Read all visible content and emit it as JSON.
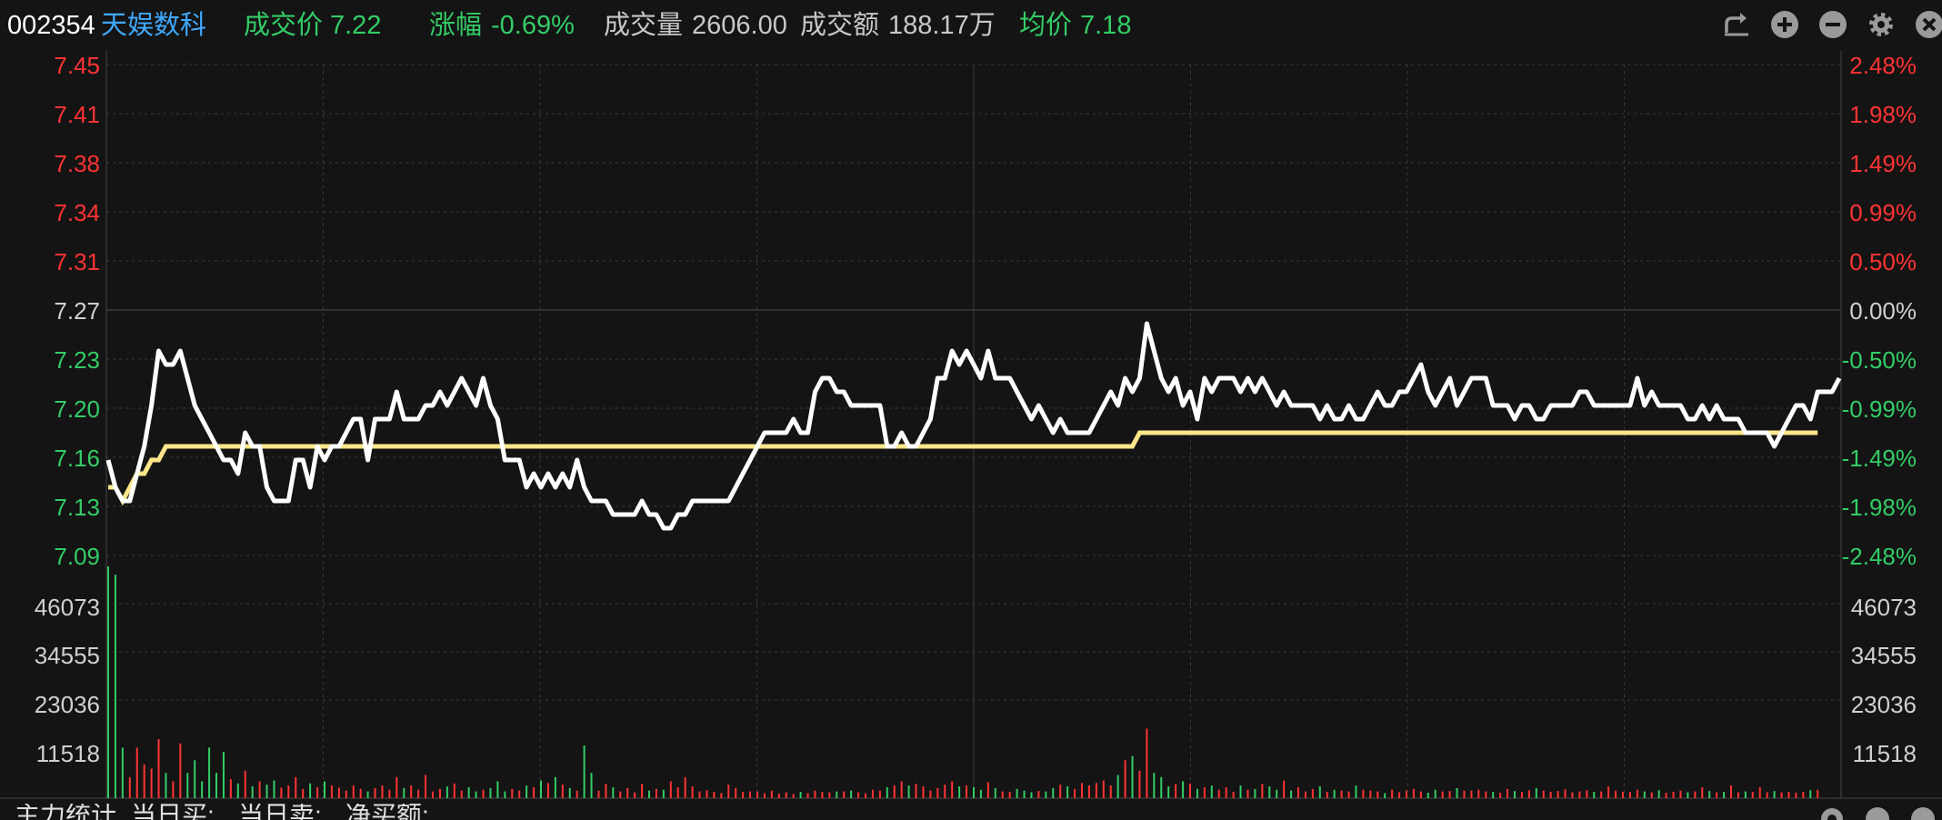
{
  "header": {
    "code": "002354",
    "name": "天娱数科",
    "price_label": "成交价",
    "price": "7.22",
    "change_label": "涨幅",
    "change": "-0.69%",
    "volume_label": "成交量",
    "volume": "2606.00",
    "amount_label": "成交额",
    "amount": "188.17万",
    "avg_label": "均价",
    "avg": "7.18",
    "icons": [
      "refresh-icon",
      "zoom-in-icon",
      "zoom-out-icon",
      "gear-icon",
      "close-icon"
    ]
  },
  "footer": {
    "l1": "主力统计",
    "l2": "当日买:",
    "l3": "当日卖:",
    "l4": "净买额:",
    "icons": [
      "gear-icon",
      "help-icon",
      "close-icon"
    ]
  },
  "colors": {
    "up": "#ff3333",
    "down": "#33cc66",
    "price_line": "#ffffff",
    "avg_line": "#ffe68a",
    "grid": "#3a3a3a",
    "accent": "#3fa9ff"
  },
  "chart_data": {
    "type": "line",
    "price_ylim": [
      7.09,
      7.45
    ],
    "left_ticks": [
      "7.45",
      "7.41",
      "7.38",
      "7.34",
      "7.31",
      "7.27",
      "7.23",
      "7.20",
      "7.16",
      "7.13",
      "7.09"
    ],
    "right_ticks": [
      "2.48%",
      "1.98%",
      "1.49%",
      "0.99%",
      "0.50%",
      "0.00%",
      "-0.50%",
      "-0.99%",
      "-1.49%",
      "-1.98%",
      "-2.48%"
    ],
    "prev_close": 7.27,
    "volume_ylim": [
      0,
      57591
    ],
    "volume_ticks": [
      "46073",
      "34555",
      "23036",
      "11518"
    ],
    "total_points": 241,
    "price": [
      7.16,
      7.14,
      7.13,
      7.13,
      7.15,
      7.17,
      7.2,
      7.24,
      7.23,
      7.23,
      7.24,
      7.22,
      7.2,
      7.19,
      7.18,
      7.17,
      7.16,
      7.16,
      7.15,
      7.18,
      7.17,
      7.17,
      7.14,
      7.13,
      7.13,
      7.13,
      7.16,
      7.16,
      7.14,
      7.17,
      7.16,
      7.17,
      7.17,
      7.18,
      7.19,
      7.19,
      7.16,
      7.19,
      7.19,
      7.19,
      7.21,
      7.19,
      7.19,
      7.19,
      7.2,
      7.2,
      7.21,
      7.2,
      7.21,
      7.22,
      7.21,
      7.2,
      7.22,
      7.2,
      7.19,
      7.16,
      7.16,
      7.16,
      7.14,
      7.15,
      7.14,
      7.15,
      7.14,
      7.15,
      7.14,
      7.16,
      7.14,
      7.13,
      7.13,
      7.13,
      7.12,
      7.12,
      7.12,
      7.12,
      7.13,
      7.12,
      7.12,
      7.11,
      7.11,
      7.12,
      7.12,
      7.13,
      7.13,
      7.13,
      7.13,
      7.13,
      7.13,
      7.14,
      7.15,
      7.16,
      7.17,
      7.18,
      7.18,
      7.18,
      7.18,
      7.19,
      7.18,
      7.18,
      7.21,
      7.22,
      7.22,
      7.21,
      7.21,
      7.2,
      7.2,
      7.2,
      7.2,
      7.2,
      7.17,
      7.17,
      7.18,
      7.17,
      7.17,
      7.18,
      7.19,
      7.22,
      7.22,
      7.24,
      7.23,
      7.24,
      7.23,
      7.22,
      7.24,
      7.22,
      7.22,
      7.22,
      7.21,
      7.2,
      7.19,
      7.2,
      7.19,
      7.18,
      7.19,
      7.18,
      7.18,
      7.18,
      7.18,
      7.19,
      7.2,
      7.21,
      7.2,
      7.22,
      7.21,
      7.22,
      7.26,
      7.24,
      7.22,
      7.21,
      7.22,
      7.2,
      7.21,
      7.19,
      7.22,
      7.21,
      7.22,
      7.22,
      7.22,
      7.21,
      7.22,
      7.21,
      7.22,
      7.21,
      7.2,
      7.21,
      7.2,
      7.2,
      7.2,
      7.2,
      7.19,
      7.2,
      7.19,
      7.19,
      7.2,
      7.19,
      7.19,
      7.2,
      7.21,
      7.2,
      7.2,
      7.21,
      7.21,
      7.22,
      7.23,
      7.21,
      7.2,
      7.21,
      7.22,
      7.2,
      7.21,
      7.22,
      7.22,
      7.22,
      7.2,
      7.2,
      7.2,
      7.19,
      7.2,
      7.2,
      7.19,
      7.19,
      7.2,
      7.2,
      7.2,
      7.2,
      7.21,
      7.21,
      7.2,
      7.2,
      7.2,
      7.2,
      7.2,
      7.2,
      7.22,
      7.2,
      7.21,
      7.2,
      7.2,
      7.2,
      7.2,
      7.19,
      7.19,
      7.2,
      7.19,
      7.2,
      7.19,
      7.19,
      7.19,
      7.18,
      7.18,
      7.18,
      7.18,
      7.17,
      7.18,
      7.19,
      7.2,
      7.2,
      7.19,
      7.21,
      7.21,
      7.21,
      7.22
    ],
    "avg_price": [
      7.14,
      7.14,
      7.13,
      7.14,
      7.15,
      7.15,
      7.16,
      7.16,
      7.17,
      7.17,
      7.17,
      7.17,
      7.17,
      7.17,
      7.17,
      7.17,
      7.17,
      7.17,
      7.17,
      7.17,
      7.17,
      7.17,
      7.17,
      7.17,
      7.17,
      7.17,
      7.17,
      7.17,
      7.17,
      7.17,
      7.17,
      7.17,
      7.17,
      7.17,
      7.17,
      7.17,
      7.17,
      7.17,
      7.17,
      7.17,
      7.17,
      7.17,
      7.17,
      7.17,
      7.17,
      7.17,
      7.17,
      7.17,
      7.17,
      7.17,
      7.17,
      7.17,
      7.17,
      7.17,
      7.17,
      7.17,
      7.17,
      7.17,
      7.17,
      7.17,
      7.17,
      7.17,
      7.17,
      7.17,
      7.17,
      7.17,
      7.17,
      7.17,
      7.17,
      7.17,
      7.17,
      7.17,
      7.17,
      7.17,
      7.17,
      7.17,
      7.17,
      7.17,
      7.17,
      7.17,
      7.17,
      7.17,
      7.17,
      7.17,
      7.17,
      7.17,
      7.17,
      7.17,
      7.17,
      7.17,
      7.17,
      7.17,
      7.17,
      7.17,
      7.17,
      7.17,
      7.17,
      7.17,
      7.17,
      7.17,
      7.17,
      7.17,
      7.17,
      7.17,
      7.17,
      7.17,
      7.17,
      7.17,
      7.17,
      7.17,
      7.17,
      7.17,
      7.17,
      7.17,
      7.17,
      7.17,
      7.17,
      7.17,
      7.17,
      7.17,
      7.17,
      7.17,
      7.17,
      7.17,
      7.17,
      7.17,
      7.17,
      7.17,
      7.17,
      7.17,
      7.17,
      7.17,
      7.17,
      7.17,
      7.17,
      7.17,
      7.17,
      7.17,
      7.17,
      7.17,
      7.17,
      7.17,
      7.17,
      7.18,
      7.18,
      7.18,
      7.18,
      7.18,
      7.18,
      7.18,
      7.18,
      7.18,
      7.18,
      7.18,
      7.18,
      7.18,
      7.18,
      7.18,
      7.18,
      7.18,
      7.18,
      7.18,
      7.18,
      7.18,
      7.18,
      7.18,
      7.18,
      7.18,
      7.18,
      7.18,
      7.18,
      7.18,
      7.18,
      7.18,
      7.18,
      7.18,
      7.18,
      7.18,
      7.18,
      7.18,
      7.18,
      7.18,
      7.18,
      7.18,
      7.18,
      7.18,
      7.18,
      7.18,
      7.18,
      7.18,
      7.18,
      7.18,
      7.18,
      7.18,
      7.18,
      7.18,
      7.18,
      7.18,
      7.18,
      7.18,
      7.18,
      7.18,
      7.18,
      7.18,
      7.18,
      7.18,
      7.18,
      7.18,
      7.18,
      7.18,
      7.18,
      7.18,
      7.18,
      7.18,
      7.18,
      7.18,
      7.18,
      7.18,
      7.18,
      7.18,
      7.18,
      7.18,
      7.18,
      7.18,
      7.18,
      7.18,
      7.18,
      7.18,
      7.18,
      7.18,
      7.18,
      7.18,
      7.18,
      7.18,
      7.18,
      7.18,
      7.18,
      7.18
    ],
    "volume": [
      55000,
      53000,
      12000,
      5000,
      12000,
      8000,
      7000,
      14000,
      6000,
      4000,
      13000,
      6000,
      9000,
      4000,
      12000,
      6000,
      11000,
      4500,
      3500,
      6500,
      2800,
      4000,
      3200,
      4200,
      2500,
      3000,
      5000,
      2200,
      3500,
      2600,
      4000,
      3000,
      2500,
      1800,
      3000,
      2200,
      1600,
      2400,
      3000,
      2000,
      5000,
      2400,
      3000,
      2000,
      5500,
      1600,
      2200,
      2800,
      3500,
      1800,
      2600,
      1600,
      2000,
      2400,
      4000,
      1600,
      2200,
      1800,
      3000,
      2600,
      4200,
      3600,
      5000,
      3200,
      2400,
      1800,
      12500,
      6000,
      1800,
      3400,
      2600,
      1600,
      2400,
      1400,
      3400,
      1800,
      2200,
      2000,
      4000,
      2600,
      5000,
      2800,
      1600,
      1900,
      1500,
      1200,
      3200,
      2400,
      1500,
      1600,
      1600,
      1200,
      1800,
      1100,
      1400,
      1000,
      1500,
      1200,
      1800,
      1500,
      1400,
      1600,
      1600,
      1800,
      1400,
      1200,
      2000,
      1800,
      2600,
      3000,
      4000,
      3000,
      3400,
      2800,
      1800,
      2400,
      3200,
      4000,
      2800,
      3000,
      2600,
      2000,
      3800,
      2400,
      1600,
      1500,
      2200,
      1800,
      1400,
      1700,
      1600,
      2400,
      3200,
      2800,
      2200,
      3600,
      3000,
      3600,
      4200,
      3000,
      5500,
      9000,
      10000,
      6500,
      16500,
      6000,
      5000,
      2800,
      3400,
      4000,
      3500,
      2200,
      2600,
      3000,
      2000,
      2600,
      1500,
      3000,
      2000,
      2200,
      3400,
      2800,
      2000,
      4200,
      1800,
      2600,
      1600,
      2200,
      2800,
      1500,
      2000,
      1800,
      1600,
      3000,
      2000,
      1800,
      1600,
      1200,
      2000,
      1400,
      1800,
      2200,
      1600,
      1300,
      2000,
      1600,
      1700,
      2400,
      1800,
      1800,
      2000,
      1600,
      1500,
      1300,
      2200,
      1700,
      1500,
      1900,
      2400,
      1800,
      1500,
      1700,
      2100,
      1400,
      1600,
      1900,
      1500,
      1600,
      2800,
      1800,
      1500,
      1500,
      2000,
      1600,
      1400,
      1900,
      1300,
      1500,
      1800,
      1400,
      1600,
      2600,
      1700,
      1400,
      1500,
      3000,
      1400,
      1600,
      1500,
      2600,
      1400,
      1700,
      1400,
      1500,
      1300,
      1500,
      1900,
      2000
    ],
    "volume_color_hint": "red when price rises vs previous bar, green when it falls"
  }
}
